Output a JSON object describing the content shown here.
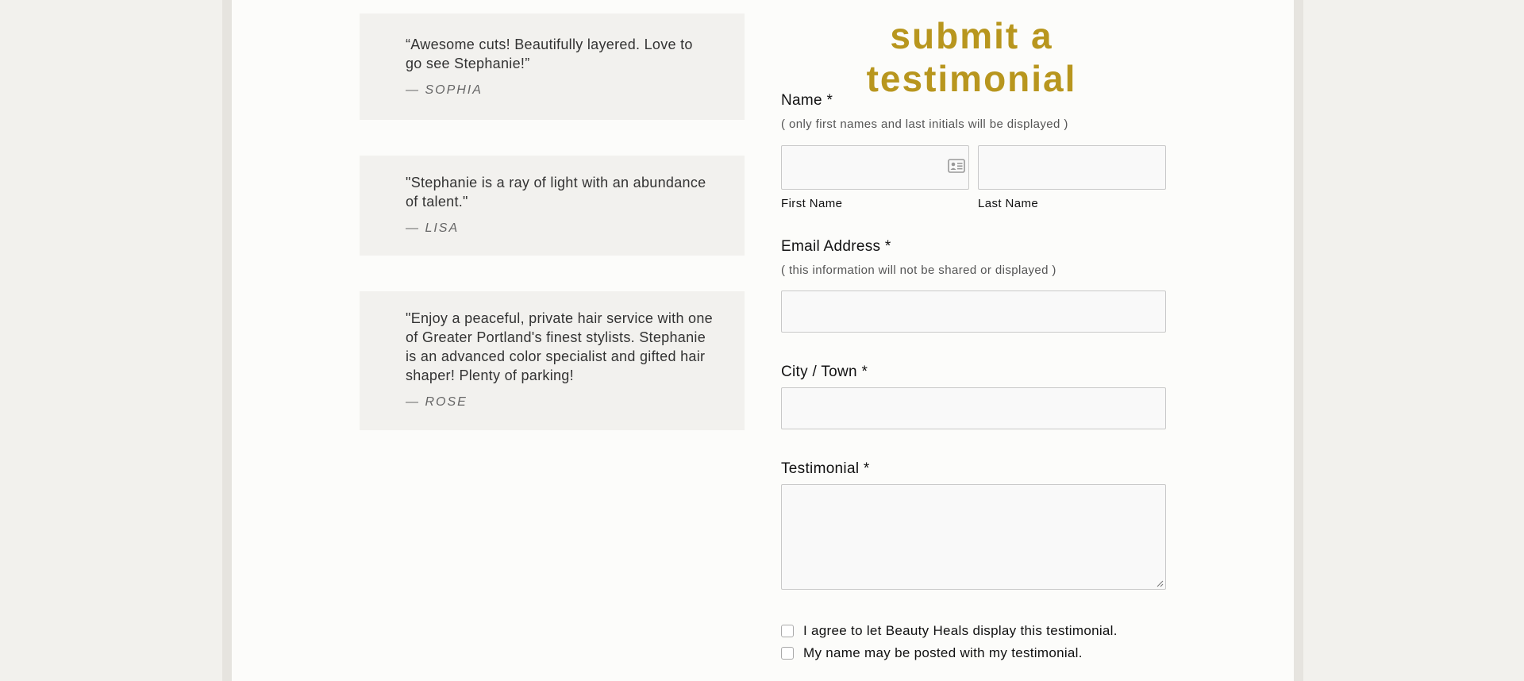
{
  "testimonials": [
    {
      "quote": "“Awesome cuts! Beautifully layered. Love to go see Stephanie!”",
      "author": "— SOPHIA"
    },
    {
      "quote": "\"Stephanie is a ray of light with an abundance of talent.\"",
      "author": "— LISA"
    },
    {
      "quote": "\"Enjoy a peaceful, private hair service with one of Greater Portland's finest stylists. Stephanie is an advanced color specialist and gifted hair shaper! Plenty of parking!",
      "author": "— ROSE"
    }
  ],
  "form": {
    "title": "submit a testimonial",
    "name": {
      "label": "Name *",
      "hint": "( only first names and last initials will be displayed )",
      "first_label": "First Name",
      "last_label": "Last Name",
      "first_value": "",
      "last_value": ""
    },
    "email": {
      "label": "Email Address *",
      "hint": "( this information will not be shared or displayed )",
      "value": ""
    },
    "city": {
      "label": "City / Town *",
      "value": ""
    },
    "testimonial": {
      "label": "Testimonial *",
      "value": ""
    },
    "checkboxes": [
      {
        "label": "I agree to let Beauty Heals display this testimonial.",
        "checked": false
      },
      {
        "label": "My name may be posted with my testimonial.",
        "checked": false
      }
    ]
  },
  "icons": {
    "contact_card": "contact-card-icon",
    "resize": "resize-handle-icon"
  },
  "colors": {
    "accent": "#b8961e",
    "page_bg": "#f2f1ed",
    "content_bg": "#fcfcfa",
    "card_bg": "#f2f1ee"
  }
}
